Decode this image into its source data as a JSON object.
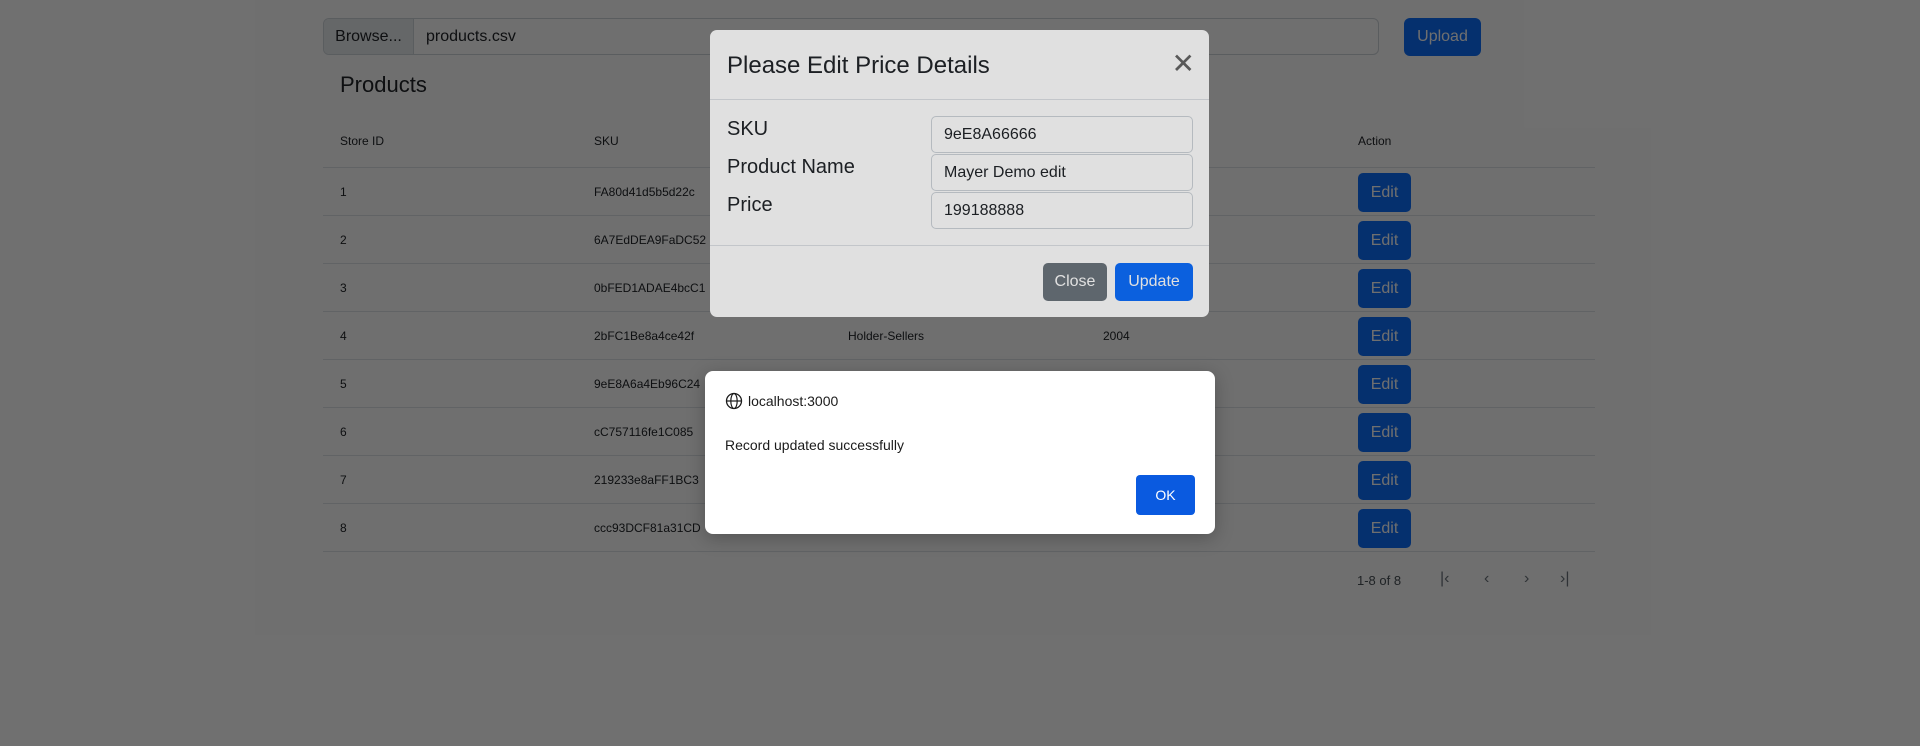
{
  "upload": {
    "browse_label": "Browse...",
    "file_name": "products.csv",
    "upload_label": "Upload"
  },
  "products_title": "Products",
  "table": {
    "headers": [
      "Store ID",
      "SKU",
      "",
      "",
      "Action"
    ],
    "rows": [
      {
        "store_id": "1",
        "sku": "FA80d41d5b5d22c",
        "name": "",
        "price": "",
        "action": "Edit"
      },
      {
        "store_id": "2",
        "sku": "6A7EdDEA9FaDC52",
        "name": "",
        "price": "",
        "action": "Edit"
      },
      {
        "store_id": "3",
        "sku": "0bFED1ADAE4bcC1",
        "name": "",
        "price": "",
        "action": "Edit"
      },
      {
        "store_id": "4",
        "sku": "2bFC1Be8a4ce42f",
        "name": "Holder-Sellers",
        "price": "2004",
        "action": "Edit"
      },
      {
        "store_id": "5",
        "sku": "9eE8A6a4Eb96C24",
        "name": "",
        "price": "",
        "action": "Edit"
      },
      {
        "store_id": "6",
        "sku": "cC757116fe1C085",
        "name": "",
        "price": "",
        "action": "Edit"
      },
      {
        "store_id": "7",
        "sku": "219233e8aFF1BC3",
        "name": "",
        "price": "",
        "action": "Edit"
      },
      {
        "store_id": "8",
        "sku": "ccc93DCF81a31CD",
        "name": "",
        "price": "",
        "action": "Edit"
      }
    ]
  },
  "pagination": {
    "range_text": "1-8 of 8",
    "first": "|‹",
    "prev": "‹",
    "next": "›",
    "last": "›|"
  },
  "modal": {
    "title": "Please Edit Price Details",
    "close_glyph": "✕",
    "sku_label": "SKU",
    "sku_value": "9eE8A66666",
    "name_label": "Product Name",
    "name_value": "Mayer Demo edit",
    "price_label": "Price",
    "price_value": "199188888",
    "close_label": "Close",
    "update_label": "Update"
  },
  "alert": {
    "origin": "localhost:3000",
    "message": "Record updated successfully",
    "ok_label": "OK"
  }
}
